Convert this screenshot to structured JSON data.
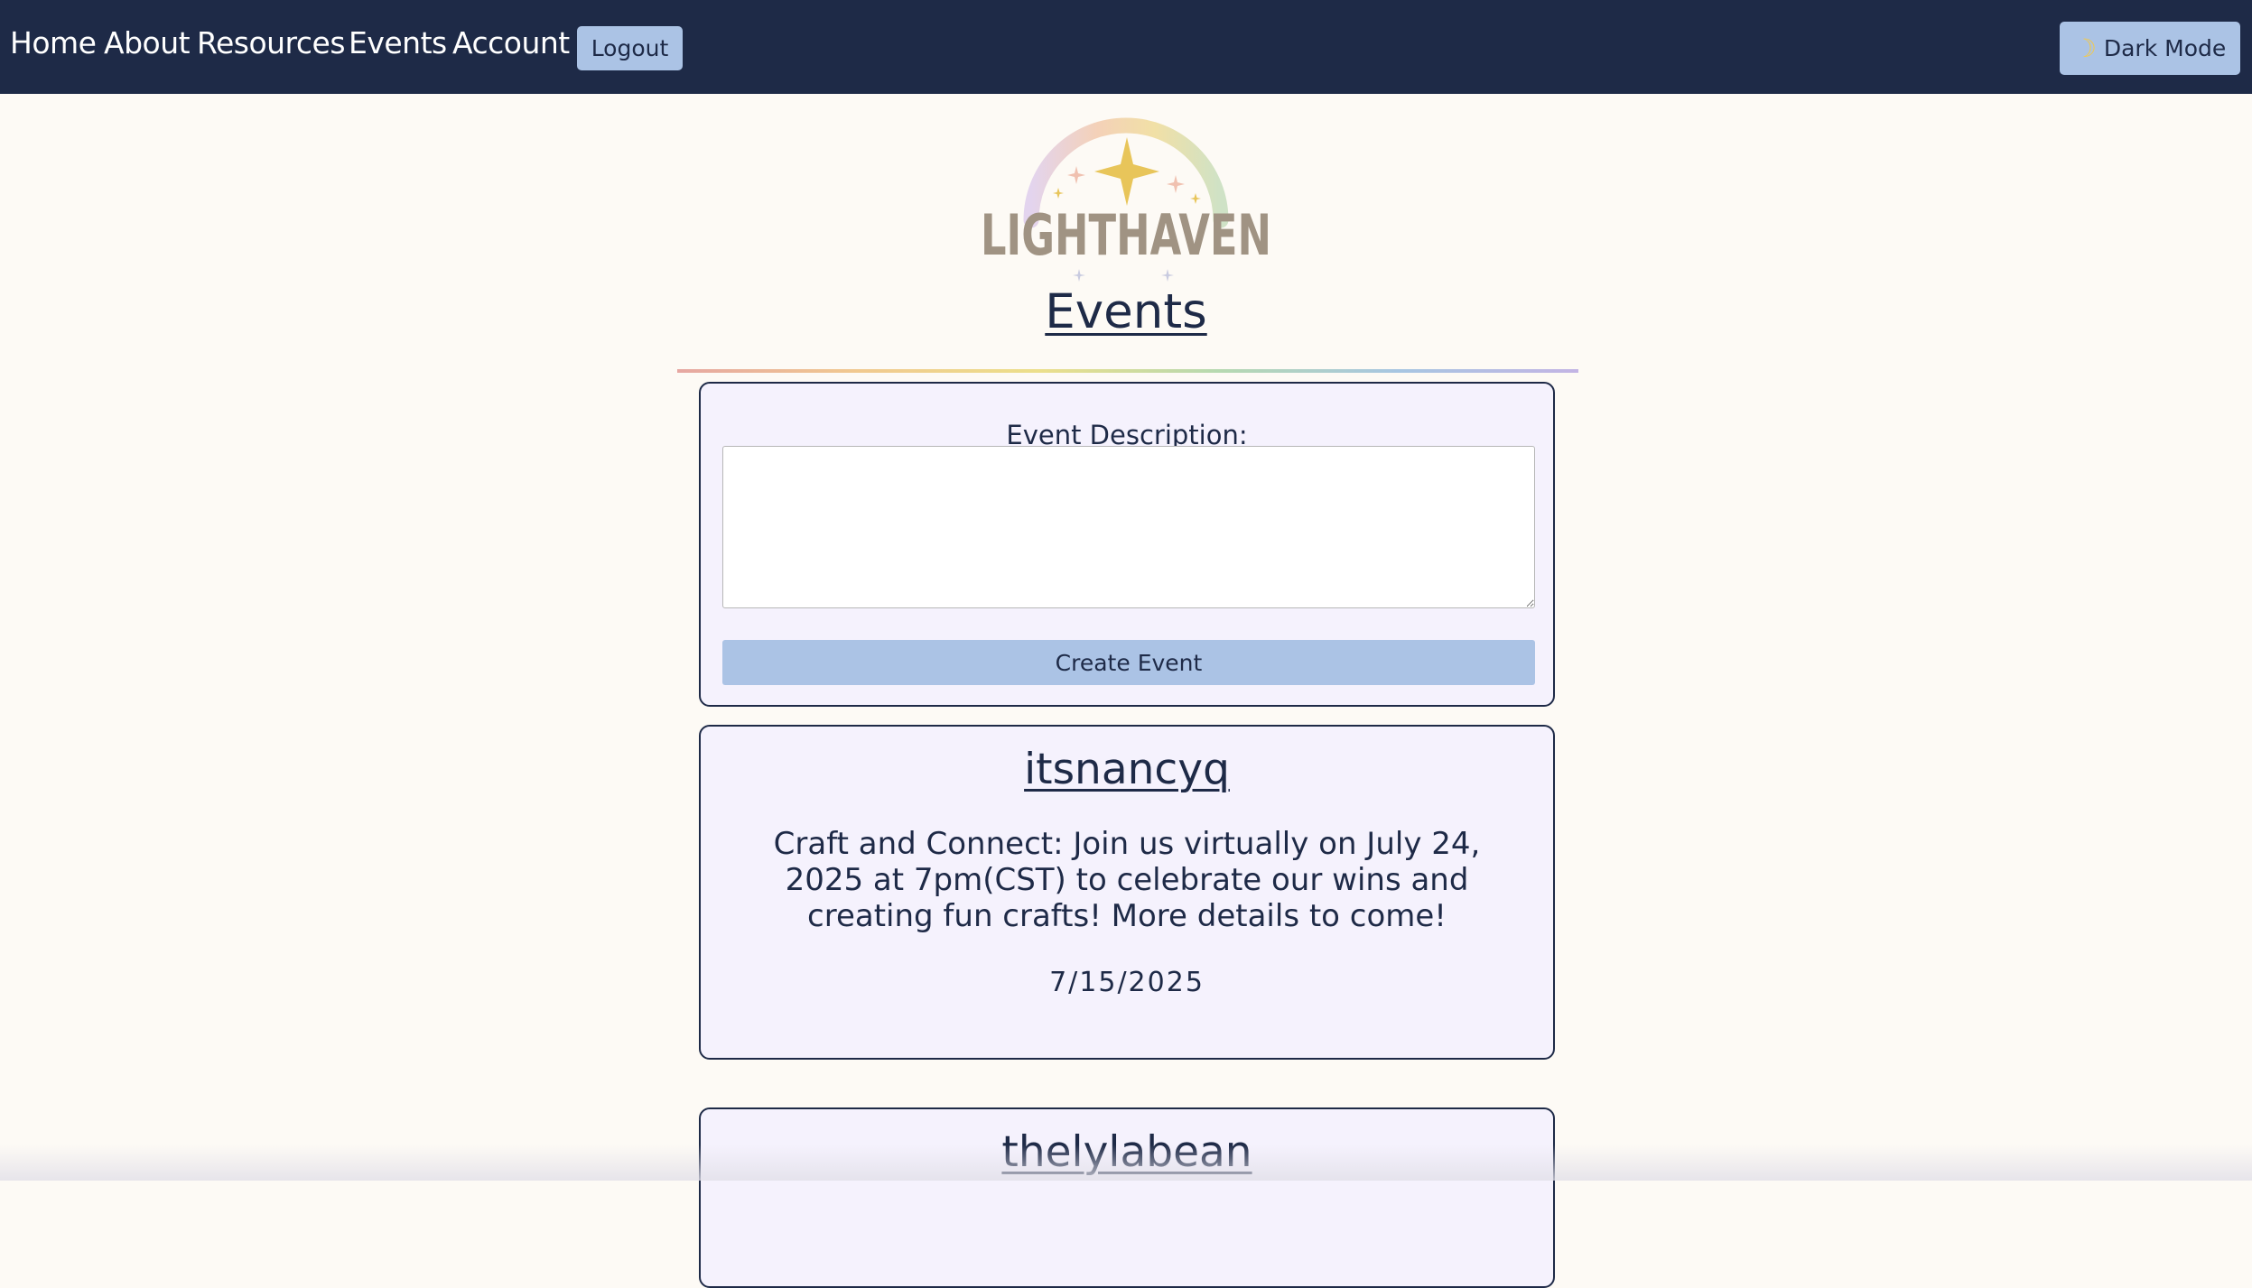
{
  "nav": {
    "links": [
      "Home",
      "About",
      "Resources",
      "Events",
      "Account"
    ],
    "logout_label": "Logout",
    "dark_mode_label": "Dark Mode",
    "dark_mode_icon": "moon-icon"
  },
  "logo": {
    "text": "LIGHTHAVEN"
  },
  "page": {
    "title": "Events"
  },
  "form": {
    "label": "Event Description:",
    "input_value": "",
    "submit_label": "Create Event"
  },
  "events": [
    {
      "user": "itsnancyq",
      "text": "Craft and Connect: Join us virtually on July 24, 2025 at 7pm(CST) to celebrate our wins and creating fun crafts! More details to come!",
      "date": "7/15/2025"
    },
    {
      "user": "thelylabean"
    }
  ],
  "colors": {
    "navbar": "#1e2a47",
    "button": "#abc3e5",
    "page_bg": "#fdfaf5",
    "card_bg": "#f5f2fd",
    "logo_text": "#a09383",
    "star": "#e8c55a"
  }
}
